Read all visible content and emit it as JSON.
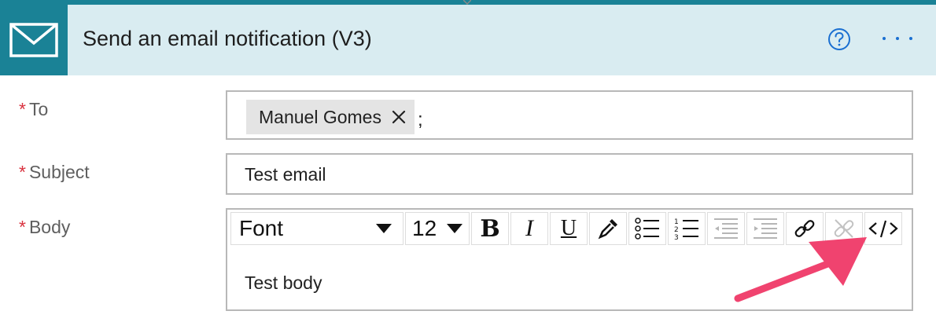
{
  "header": {
    "title": "Send an email notification (V3)",
    "icon": "mail-icon",
    "help_icon": "help-icon",
    "more_icon": "more-options-icon"
  },
  "fields": {
    "required_mark": "*",
    "to": {
      "label": "To",
      "recipient": "Manuel Gomes",
      "separator": ";"
    },
    "subject": {
      "label": "Subject",
      "value": "Test email"
    },
    "body": {
      "label": "Body",
      "value": "Test body",
      "toolbar": {
        "font": "Font",
        "size": "12",
        "bold": "B",
        "italic": "I",
        "underline": "U"
      }
    }
  },
  "colors": {
    "accent": "#1a8296",
    "header_bg": "#d9ecf1",
    "required": "#d9323f",
    "link_blue": "#1a6fd1",
    "annotation_arrow": "#f0436f"
  }
}
